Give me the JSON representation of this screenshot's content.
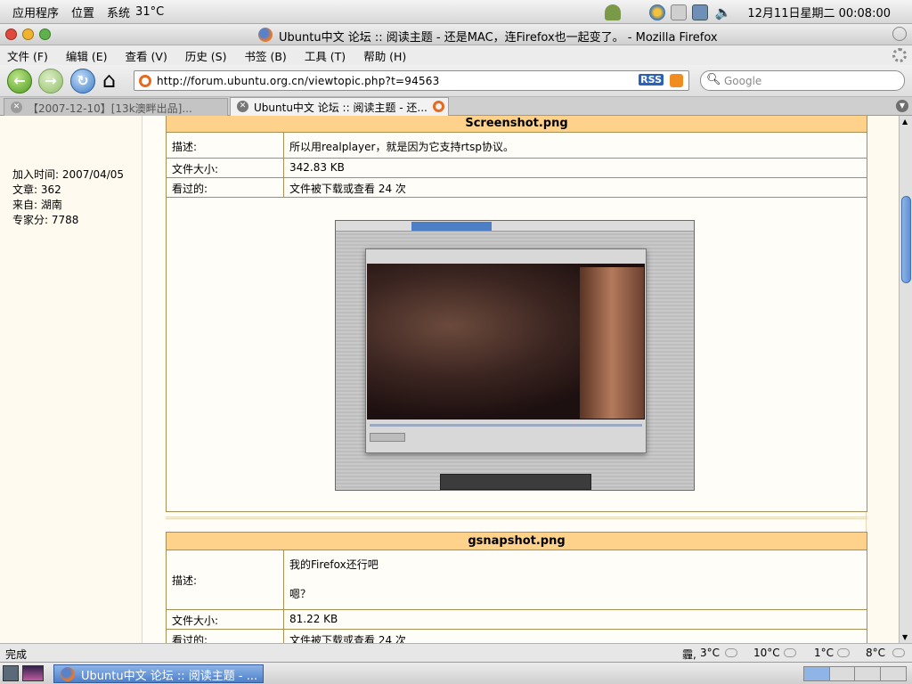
{
  "panel": {
    "apps_menu": "应用程序",
    "places_menu": "位置",
    "system_menu": "系统",
    "weather": "31°C",
    "clock": "12月11日星期二 00:08:00"
  },
  "window": {
    "title": "Ubuntu中文 论坛 :: 阅读主题 - 还是MAC，连Firefox也一起变了。 - Mozilla Firefox"
  },
  "menubar": [
    {
      "label": "文件 (F)"
    },
    {
      "label": "编辑 (E)"
    },
    {
      "label": "查看 (V)"
    },
    {
      "label": "历史 (S)"
    },
    {
      "label": "书签 (B)"
    },
    {
      "label": "工具 (T)"
    },
    {
      "label": "帮助 (H)"
    }
  ],
  "navbar": {
    "url": "http://forum.ubuntu.org.cn/viewtopic.php?t=94563",
    "rss": "RSS",
    "search_placeholder": "Google"
  },
  "tabs": [
    {
      "label": "【2007-12-10】[13k澳畔出品]..."
    },
    {
      "label": "Ubuntu中文 论坛 :: 阅读主题 - 还..."
    }
  ],
  "user": {
    "joined": "加入时间: 2007/04/05",
    "posts": "文章: 362",
    "from": "来自: 湖南",
    "score": "专家分: 7788"
  },
  "attachments": [
    {
      "filename": "Screenshot.png",
      "desc_label": "描述:",
      "desc": "所以用realplayer，就是因为它支持rtsp协议。",
      "size_label": "文件大小:",
      "size": "342.83 KB",
      "views_label": "看过的:",
      "views": "文件被下载或查看 24 次"
    },
    {
      "filename": "gsnapshot.png",
      "desc_label": "描述:",
      "desc_line1": "我的Firefox还行吧",
      "desc_line2": "嗯？",
      "size_label": "文件大小:",
      "size": "81.22 KB",
      "views_label": "看过的:",
      "views": "文件被下载或查看 24 次"
    }
  ],
  "status": {
    "text": "完成",
    "weather": [
      "3°C",
      "10°C",
      "1°C",
      "8°C"
    ],
    "weather_prefix": "霾,"
  },
  "taskbar": {
    "window_label": "Ubuntu中文 论坛 :: 阅读主题 - ..."
  },
  "colors": {
    "header_orange": "#ffd28c",
    "border_brown": "#a88f55",
    "accent_blue": "#4d7fc7"
  }
}
